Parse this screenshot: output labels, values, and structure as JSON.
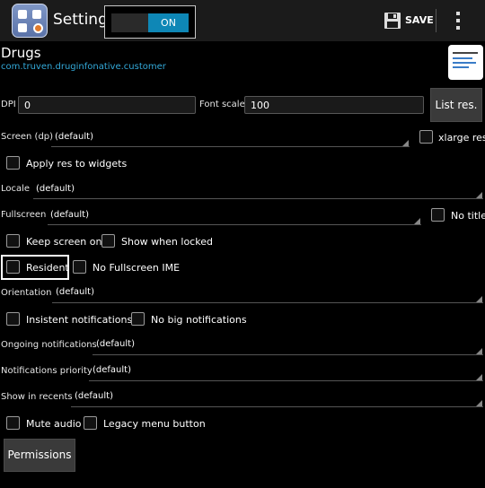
{
  "actionbar": {
    "title": "Settings",
    "toggle_label": "ON",
    "save_label": "SAVE",
    "icons": [
      "app-settings-icon",
      "save-icon",
      "overflow-menu-icon"
    ]
  },
  "app": {
    "name": "Drugs",
    "package": "com.truven.druginfonative.customer"
  },
  "dpi": {
    "label": "DPI",
    "value": "0"
  },
  "font_scale": {
    "label": "Font scale",
    "value": "100"
  },
  "list_res_label": "List res.",
  "screen": {
    "label": "Screen (dp)",
    "value": "(default)"
  },
  "xlarge_label": "xlarge res.",
  "apply_res_label": "Apply res to widgets",
  "locale": {
    "label": "Locale",
    "value": "(default)"
  },
  "fullscreen": {
    "label": "Fullscreen",
    "value": "(default)"
  },
  "no_title_label": "No title",
  "keep_screen_on_label": "Keep screen on",
  "show_when_locked_label": "Show when locked",
  "resident_label": "Resident",
  "no_fullscreen_ime_label": "No Fullscreen IME",
  "orientation": {
    "label": "Orientation",
    "value": "(default)"
  },
  "insistent_label": "Insistent notifications",
  "no_big_label": "No big notifications",
  "ongoing": {
    "label": "Ongoing notifications",
    "value": "(default)"
  },
  "priority": {
    "label": "Notifications priority",
    "value": "(default)"
  },
  "recents": {
    "label": "Show in recents",
    "value": "(default)"
  },
  "mute_audio_label": "Mute audio",
  "legacy_menu_label": "Legacy menu button",
  "permissions_label": "Permissions",
  "colors": {
    "accent": "#0e87b6",
    "link": "#33a9d9",
    "background": "#000000"
  }
}
